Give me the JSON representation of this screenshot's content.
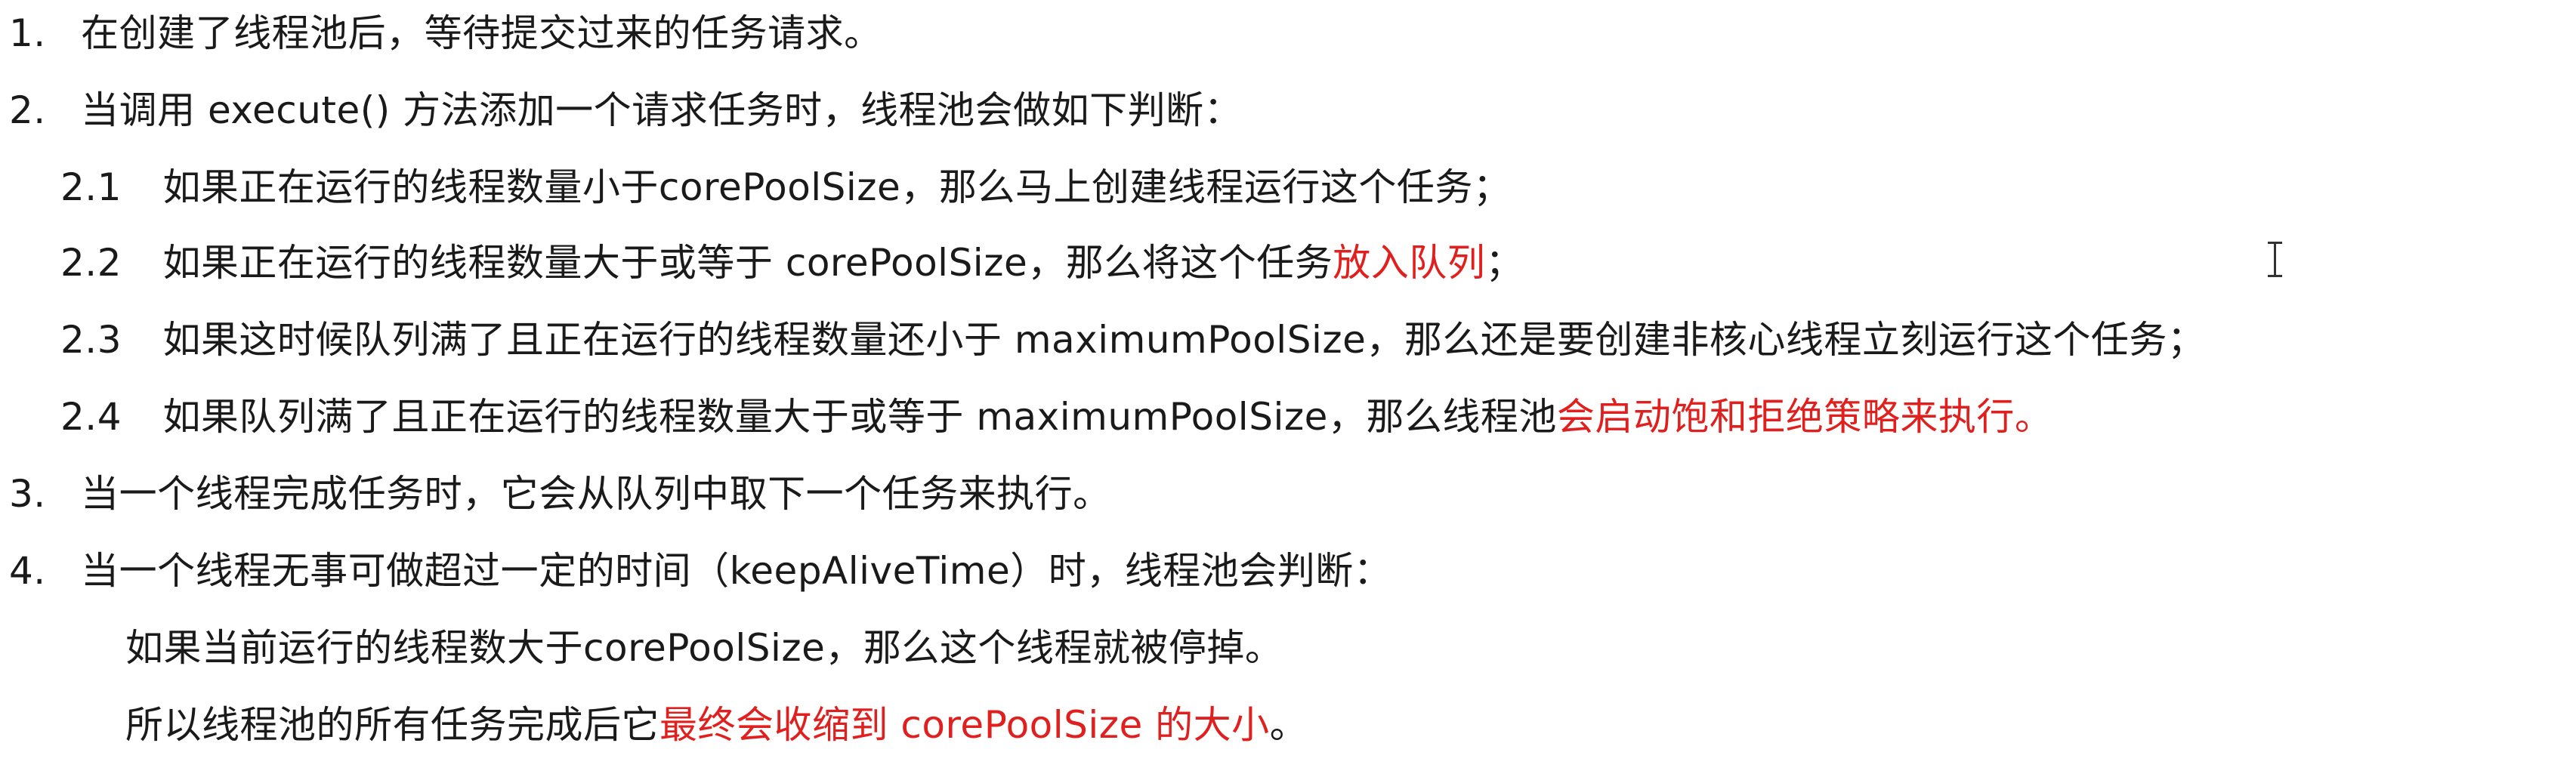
{
  "items": [
    {
      "number": "1.",
      "text": "在创建了线程池后，等待提交过来的任务请求。"
    },
    {
      "number": "2.",
      "text": "当调用 execute() 方法添加一个请求任务时，线程池会做如下判断："
    },
    {
      "number": "2.1",
      "text": "如果正在运行的线程数量小于corePoolSize，那么马上创建线程运行这个任务；"
    },
    {
      "number": "2.2",
      "text_before": "如果正在运行的线程数量大于或等于 corePoolSize，那么将这个任务",
      "highlight": "放入队列",
      "text_after": "；"
    },
    {
      "number": "2.3",
      "text": "如果这时候队列满了且正在运行的线程数量还小于 maximumPoolSize，那么还是要创建非核心线程立刻运行这个任务；"
    },
    {
      "number": "2.4",
      "text_before": "如果队列满了且正在运行的线程数量大于或等于 maximumPoolSize，那么线程池",
      "highlight": "会启动饱和拒绝策略来执行。"
    },
    {
      "number": "3.",
      "text": "当一个线程完成任务时，它会从队列中取下一个任务来执行。"
    },
    {
      "number": "4.",
      "text": "当一个线程无事可做超过一定的时间（keepAliveTime）时，线程池会判断："
    },
    {
      "text": "如果当前运行的线程数大于corePoolSize，那么这个线程就被停掉。"
    },
    {
      "text_before": "所以线程池的所有任务完成后它",
      "highlight": "最终会收缩到 corePoolSize 的大小",
      "text_after": "。"
    }
  ],
  "colors": {
    "text": "#1a1a1a",
    "highlight": "#e0201e",
    "background": "#ffffff"
  },
  "cursor_icon": "text-cursor-icon"
}
